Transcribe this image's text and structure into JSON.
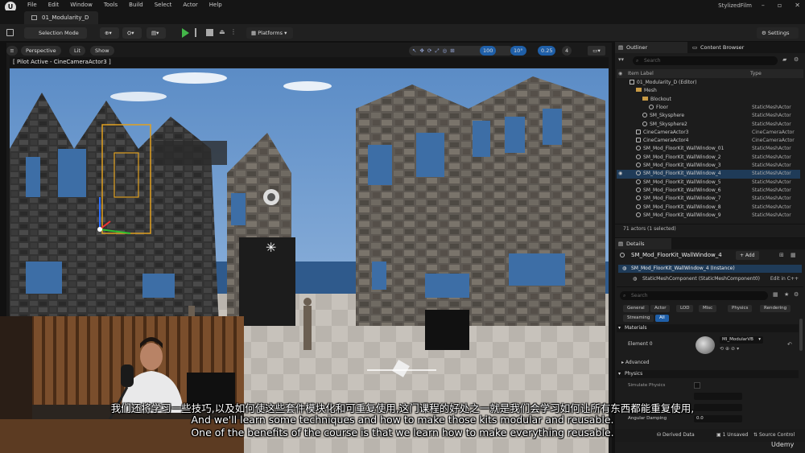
{
  "menubar": {
    "items": [
      "File",
      "Edit",
      "Window",
      "Tools",
      "Build",
      "Select",
      "Actor",
      "Help"
    ],
    "app_title": "StylizedFilm",
    "window_controls": [
      "–",
      "▫",
      "✕"
    ]
  },
  "tab": {
    "label": "01_Modularity_D"
  },
  "toolbar": {
    "mode": "Selection Mode",
    "platforms": "Platforms",
    "settings": "Settings"
  },
  "viewport": {
    "perspective": "Perspective",
    "lit": "Lit",
    "show": "Show",
    "pilot": "[ Pilot Active - CineCameraActor3 ]",
    "grid_size": "100",
    "rot_snap": "10°",
    "scale_snap": "0.25",
    "cam_speed": "4"
  },
  "outliner": {
    "tab": "Outliner",
    "tab2": "Content Browser",
    "search_placeholder": "Search",
    "col_label": "Item Label",
    "col_type": "Type",
    "rows": [
      {
        "label": "01_Modularity_D (Editor)",
        "type": "",
        "indent": 1,
        "icon": "level"
      },
      {
        "label": "Mesh",
        "type": "",
        "indent": 2,
        "icon": "folder"
      },
      {
        "label": "Blockout",
        "type": "",
        "indent": 3,
        "icon": "folder"
      },
      {
        "label": "Floor",
        "type": "StaticMeshActor",
        "indent": 4,
        "icon": "mesh"
      },
      {
        "label": "SM_Skysphere",
        "type": "StaticMeshActor",
        "indent": 3,
        "icon": "mesh"
      },
      {
        "label": "SM_Skysphere2",
        "type": "StaticMeshActor",
        "indent": 3,
        "icon": "mesh"
      },
      {
        "label": "CineCameraActor3",
        "type": "CineCameraActor",
        "indent": 2,
        "icon": "camera"
      },
      {
        "label": "CineCameraActor4",
        "type": "CineCameraActor",
        "indent": 2,
        "icon": "camera"
      },
      {
        "label": "SM_Mod_FloorKit_WallWindow_01",
        "type": "StaticMeshActor",
        "indent": 2,
        "icon": "mesh"
      },
      {
        "label": "SM_Mod_FloorKit_WallWindow_2",
        "type": "StaticMeshActor",
        "indent": 2,
        "icon": "mesh"
      },
      {
        "label": "SM_Mod_FloorKit_WallWindow_3",
        "type": "StaticMeshActor",
        "indent": 2,
        "icon": "mesh"
      },
      {
        "label": "SM_Mod_FloorKit_WallWindow_4",
        "type": "StaticMeshActor",
        "indent": 2,
        "icon": "mesh",
        "selected": true
      },
      {
        "label": "SM_Mod_FloorKit_WallWindow_5",
        "type": "StaticMeshActor",
        "indent": 2,
        "icon": "mesh"
      },
      {
        "label": "SM_Mod_FloorKit_WallWindow_6",
        "type": "StaticMeshActor",
        "indent": 2,
        "icon": "mesh"
      },
      {
        "label": "SM_Mod_FloorKit_WallWindow_7",
        "type": "StaticMeshActor",
        "indent": 2,
        "icon": "mesh"
      },
      {
        "label": "SM_Mod_FloorKit_WallWindow_8",
        "type": "StaticMeshActor",
        "indent": 2,
        "icon": "mesh"
      },
      {
        "label": "SM_Mod_FloorKit_WallWindow_9",
        "type": "StaticMeshActor",
        "indent": 2,
        "icon": "mesh"
      }
    ],
    "footer": "71 actors (1 selected)"
  },
  "details": {
    "tab": "Details",
    "actor_name": "SM_Mod_FloorKit_WallWindow_4",
    "add": "+ Add",
    "instance": "SM_Mod_FloorKit_WallWindow_4 (Instance)",
    "component": "StaticMeshComponent (StaticMeshComponent0)",
    "edit_cpp": "Edit in C++",
    "search_placeholder": "Search",
    "filters": [
      "General",
      "Actor",
      "LOD",
      "Misc",
      "Physics",
      "Rendering",
      "Streaming",
      "All"
    ],
    "materials_header": "Materials",
    "element0": "Element 0",
    "material_name": "MI_ModularVB",
    "advanced": "Advanced",
    "physics_header": "Physics",
    "simulate": "Simulate Physics",
    "angular_damping": "Angular Damping",
    "angular_value": "0.0"
  },
  "statusbar": {
    "derived": "Derived Data",
    "unsaved": "1 Unsaved",
    "source": "Source Control"
  },
  "subtitles": {
    "line_cn": "我们还将学习一些技巧,以及如何使这些套件模块化和可重复使用,这门课程的好处之一就是我们会学习如何让所有东西都能重复使用,",
    "line_en1": "And we'll learn some techniques and how to make those kits modular and reusable.",
    "line_en2": "One of the benefits of the course is that we learn how to make everything reusable."
  },
  "watermark": "Udemy",
  "colors": {
    "accent": "#1f3b58",
    "play": "#43b649",
    "folder": "#c89a45",
    "sky": "#5b8cc6"
  }
}
